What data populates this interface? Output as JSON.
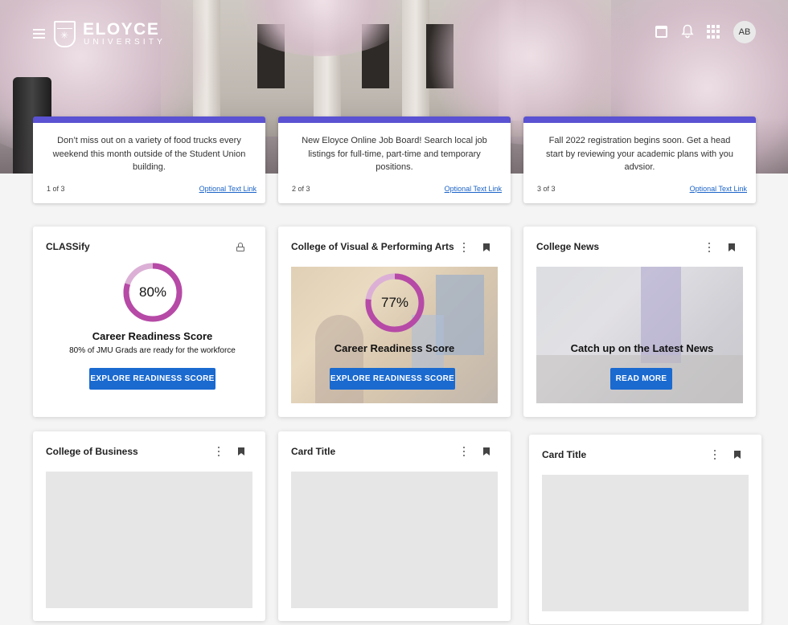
{
  "header": {
    "logo_name": "ELOYCE",
    "logo_sub": "UNIVERSITY",
    "avatar_initials": "AB"
  },
  "announcements": [
    {
      "message": "Don’t miss out on a variety of food trucks every weekend this month outside of the Student Union building.",
      "count": "1 of 3",
      "link": "Optional Text Link"
    },
    {
      "message": "New Eloyce Online Job Board! Search local job listings for full-time, part-time and temporary positions.",
      "count": "2 of 3",
      "link": "Optional Text Link"
    },
    {
      "message": "Fall 2022 registration begins soon. Get a head start by reviewing your academic plans with you advsior.",
      "count": "3 of 3",
      "link": "Optional Text Link"
    }
  ],
  "cards": {
    "classify": {
      "title": "CLASSify",
      "score_label": "80%",
      "score_value": 0.8,
      "score_title": "Career Readiness Score",
      "score_sub": "80% of JMU Grads are ready for the workforce",
      "button": "EXPLORE READINESS SCORE"
    },
    "arts": {
      "title": "College of Visual & Performing Arts",
      "score_label": "77%",
      "score_value": 0.77,
      "score_title": "Career Readiness Score",
      "button": "EXPLORE READINESS SCORE"
    },
    "news": {
      "title": "College News",
      "headline": "Catch up on the Latest News",
      "button": "READ MORE"
    },
    "business": {
      "title": "College of Business"
    },
    "card2": {
      "title": "Card Title"
    },
    "card3": {
      "title": "Card Title"
    }
  },
  "colors": {
    "accent_bar": "#5a52d2",
    "button": "#1a6ad0",
    "donut_fill": "#b64aa6",
    "donut_track": "#dcb0d6"
  }
}
